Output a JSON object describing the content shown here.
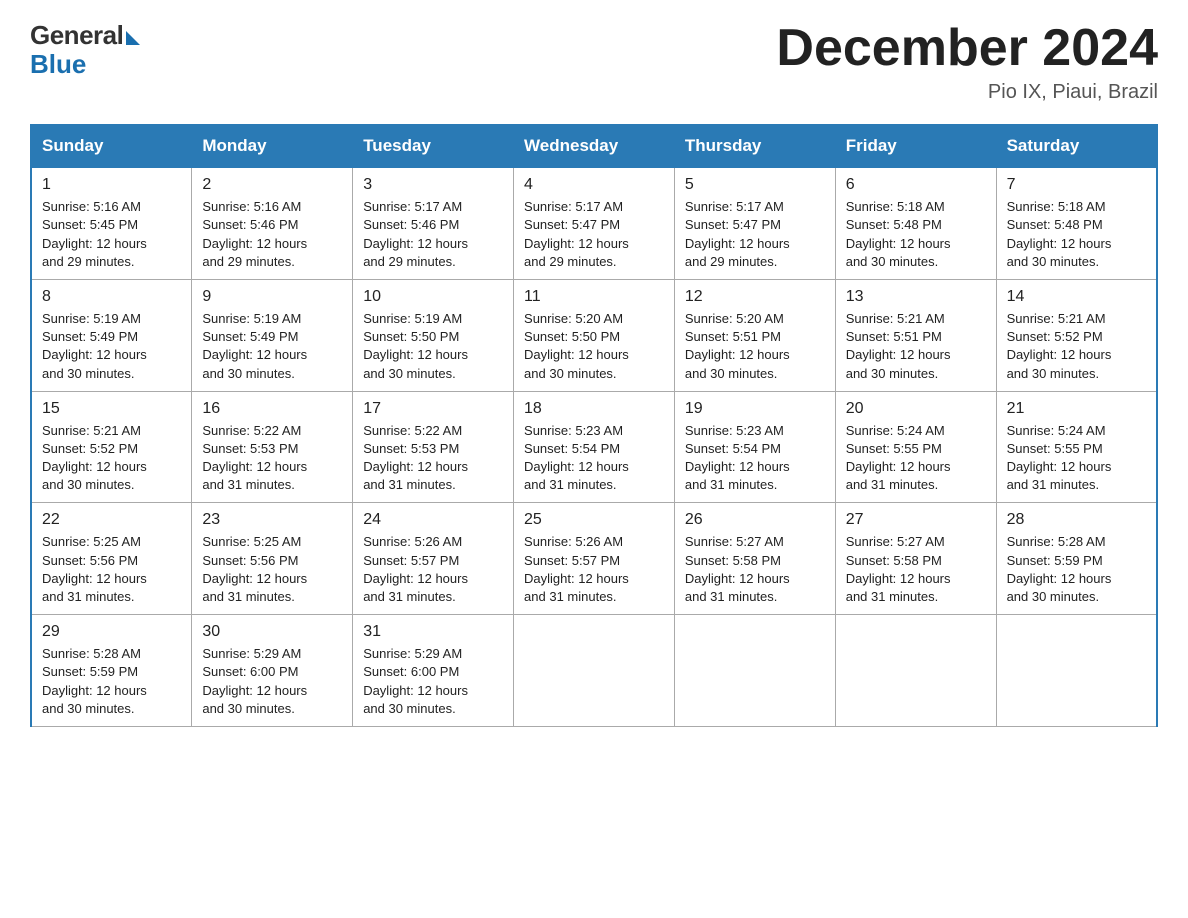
{
  "header": {
    "logo_general": "General",
    "logo_blue": "Blue",
    "month_title": "December 2024",
    "location": "Pio IX, Piaui, Brazil"
  },
  "days_of_week": [
    "Sunday",
    "Monday",
    "Tuesday",
    "Wednesday",
    "Thursday",
    "Friday",
    "Saturday"
  ],
  "weeks": [
    [
      {
        "day": "1",
        "sunrise": "5:16 AM",
        "sunset": "5:45 PM",
        "daylight": "12 hours and 29 minutes."
      },
      {
        "day": "2",
        "sunrise": "5:16 AM",
        "sunset": "5:46 PM",
        "daylight": "12 hours and 29 minutes."
      },
      {
        "day": "3",
        "sunrise": "5:17 AM",
        "sunset": "5:46 PM",
        "daylight": "12 hours and 29 minutes."
      },
      {
        "day": "4",
        "sunrise": "5:17 AM",
        "sunset": "5:47 PM",
        "daylight": "12 hours and 29 minutes."
      },
      {
        "day": "5",
        "sunrise": "5:17 AM",
        "sunset": "5:47 PM",
        "daylight": "12 hours and 29 minutes."
      },
      {
        "day": "6",
        "sunrise": "5:18 AM",
        "sunset": "5:48 PM",
        "daylight": "12 hours and 30 minutes."
      },
      {
        "day": "7",
        "sunrise": "5:18 AM",
        "sunset": "5:48 PM",
        "daylight": "12 hours and 30 minutes."
      }
    ],
    [
      {
        "day": "8",
        "sunrise": "5:19 AM",
        "sunset": "5:49 PM",
        "daylight": "12 hours and 30 minutes."
      },
      {
        "day": "9",
        "sunrise": "5:19 AM",
        "sunset": "5:49 PM",
        "daylight": "12 hours and 30 minutes."
      },
      {
        "day": "10",
        "sunrise": "5:19 AM",
        "sunset": "5:50 PM",
        "daylight": "12 hours and 30 minutes."
      },
      {
        "day": "11",
        "sunrise": "5:20 AM",
        "sunset": "5:50 PM",
        "daylight": "12 hours and 30 minutes."
      },
      {
        "day": "12",
        "sunrise": "5:20 AM",
        "sunset": "5:51 PM",
        "daylight": "12 hours and 30 minutes."
      },
      {
        "day": "13",
        "sunrise": "5:21 AM",
        "sunset": "5:51 PM",
        "daylight": "12 hours and 30 minutes."
      },
      {
        "day": "14",
        "sunrise": "5:21 AM",
        "sunset": "5:52 PM",
        "daylight": "12 hours and 30 minutes."
      }
    ],
    [
      {
        "day": "15",
        "sunrise": "5:21 AM",
        "sunset": "5:52 PM",
        "daylight": "12 hours and 30 minutes."
      },
      {
        "day": "16",
        "sunrise": "5:22 AM",
        "sunset": "5:53 PM",
        "daylight": "12 hours and 31 minutes."
      },
      {
        "day": "17",
        "sunrise": "5:22 AM",
        "sunset": "5:53 PM",
        "daylight": "12 hours and 31 minutes."
      },
      {
        "day": "18",
        "sunrise": "5:23 AM",
        "sunset": "5:54 PM",
        "daylight": "12 hours and 31 minutes."
      },
      {
        "day": "19",
        "sunrise": "5:23 AM",
        "sunset": "5:54 PM",
        "daylight": "12 hours and 31 minutes."
      },
      {
        "day": "20",
        "sunrise": "5:24 AM",
        "sunset": "5:55 PM",
        "daylight": "12 hours and 31 minutes."
      },
      {
        "day": "21",
        "sunrise": "5:24 AM",
        "sunset": "5:55 PM",
        "daylight": "12 hours and 31 minutes."
      }
    ],
    [
      {
        "day": "22",
        "sunrise": "5:25 AM",
        "sunset": "5:56 PM",
        "daylight": "12 hours and 31 minutes."
      },
      {
        "day": "23",
        "sunrise": "5:25 AM",
        "sunset": "5:56 PM",
        "daylight": "12 hours and 31 minutes."
      },
      {
        "day": "24",
        "sunrise": "5:26 AM",
        "sunset": "5:57 PM",
        "daylight": "12 hours and 31 minutes."
      },
      {
        "day": "25",
        "sunrise": "5:26 AM",
        "sunset": "5:57 PM",
        "daylight": "12 hours and 31 minutes."
      },
      {
        "day": "26",
        "sunrise": "5:27 AM",
        "sunset": "5:58 PM",
        "daylight": "12 hours and 31 minutes."
      },
      {
        "day": "27",
        "sunrise": "5:27 AM",
        "sunset": "5:58 PM",
        "daylight": "12 hours and 31 minutes."
      },
      {
        "day": "28",
        "sunrise": "5:28 AM",
        "sunset": "5:59 PM",
        "daylight": "12 hours and 30 minutes."
      }
    ],
    [
      {
        "day": "29",
        "sunrise": "5:28 AM",
        "sunset": "5:59 PM",
        "daylight": "12 hours and 30 minutes."
      },
      {
        "day": "30",
        "sunrise": "5:29 AM",
        "sunset": "6:00 PM",
        "daylight": "12 hours and 30 minutes."
      },
      {
        "day": "31",
        "sunrise": "5:29 AM",
        "sunset": "6:00 PM",
        "daylight": "12 hours and 30 minutes."
      },
      null,
      null,
      null,
      null
    ]
  ],
  "labels": {
    "sunrise": "Sunrise:",
    "sunset": "Sunset:",
    "daylight": "Daylight:"
  }
}
